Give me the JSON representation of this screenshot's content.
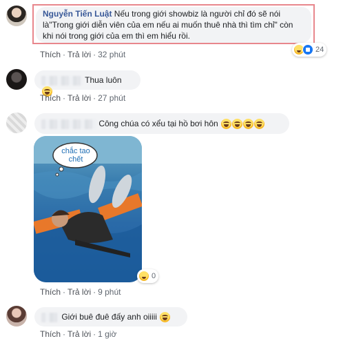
{
  "comments": [
    {
      "author": "Nguyễn Tiến Luật",
      "text": " Nếu trong giới showbiz là người chỉ đó sẽ nói là\"Trong giới diễn viên của em nếu ai muốn thuê nhà thì tìm chỉ\" còn khi nói trong giới của em thì em hiểu rồi.",
      "line1": "Nếu trong giới showbiz là người chỉ đó sẽ nói",
      "line2": "là\"Trong giới diễn viên của em nếu ai muốn thuê nhà thì tìm chỉ\" còn",
      "line3": "khi nói trong giới của em thì em hiểu rồi.",
      "like": "Thích",
      "reply": "Trả lời",
      "time": "32 phút",
      "reaction_count": "24",
      "reaction_icons": [
        "haha-icon",
        "like-icon"
      ]
    },
    {
      "text": "Thua luôn",
      "like": "Thích",
      "reply": "Trả lời",
      "time": "27 phút",
      "emoji": "laughing-emoji"
    },
    {
      "text": "Công chúa có xểu tại hồ bơi hôn",
      "like": "Thích",
      "reply": "Trả lời",
      "time": "9 phút",
      "reaction_count": "0",
      "photo_caption": "chắc tao chết",
      "emoji": "rofl-emoji"
    },
    {
      "text": "Giới buê đuê đấy anh oiiiii",
      "like": "Thích",
      "reply": "Trả lời",
      "time": "1 giờ",
      "emoji": "laughing-emoji"
    }
  ],
  "colors": {
    "name": "#385898",
    "bubble": "#f2f3f5",
    "meta": "#606770",
    "highlight": "#e8868c"
  }
}
